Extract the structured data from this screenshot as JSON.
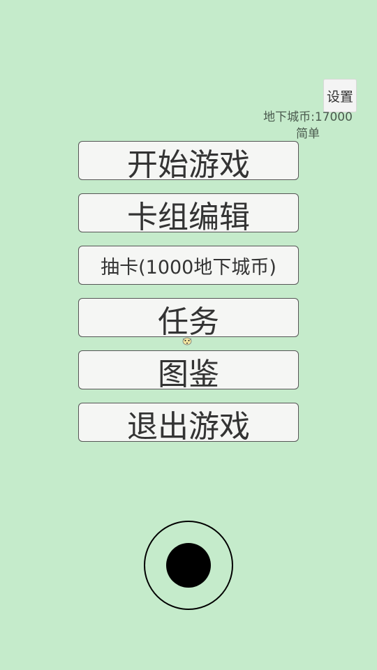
{
  "settings_label": "设置",
  "currency": {
    "text": "地下城币:17000"
  },
  "difficulty": "简单",
  "menu": {
    "start_game": "开始游戏",
    "deck_edit": "卡组编辑",
    "draw_card": "抽卡(1000地下城币)",
    "quests": "任务",
    "codex": "图鉴",
    "exit_game": "退出游戏"
  },
  "colors": {
    "background": "#c5ebcb",
    "button_bg": "#f5f6f4",
    "text": "#333333"
  },
  "icons": {
    "sprite": "small-creature-icon",
    "joystick": "virtual-joystick"
  }
}
